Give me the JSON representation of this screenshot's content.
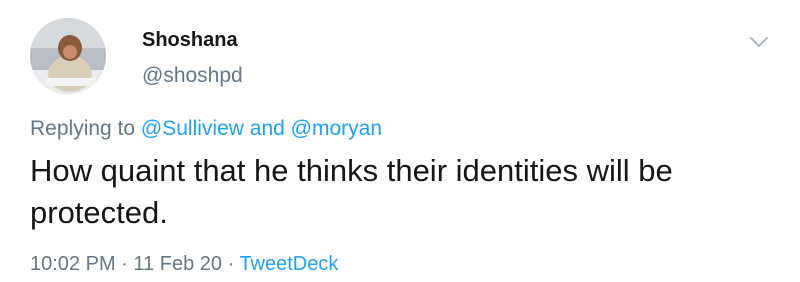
{
  "author": {
    "display_name": "Shoshana",
    "handle": "@shoshpd"
  },
  "reply": {
    "prefix": "Replying to",
    "mention_1": "@Sulliview",
    "conjunction": "and",
    "mention_2": "@moryan"
  },
  "tweet": {
    "text": "How quaint that he thinks their identities will be protected."
  },
  "meta": {
    "time": "10:02 PM",
    "separator": "·",
    "date": "11 Feb 20",
    "source": "TweetDeck"
  },
  "colors": {
    "text": "#14171a",
    "secondary": "#657786",
    "link": "#1da1f2"
  },
  "icons": {
    "menu": "chevron-down-icon"
  }
}
